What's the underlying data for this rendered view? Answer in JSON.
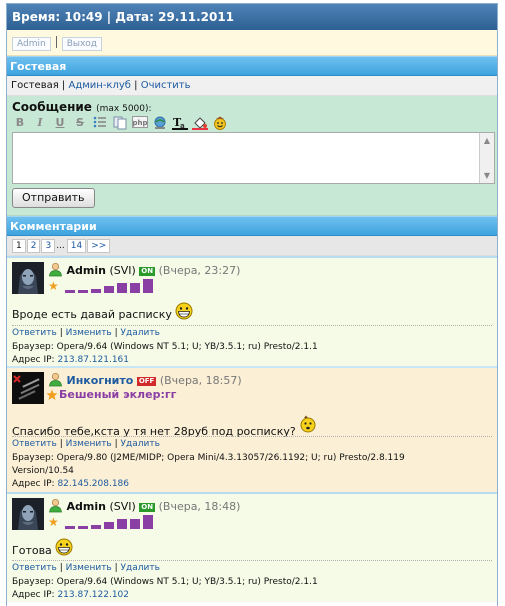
{
  "header": {
    "time_label": "Время: 10:49 | Дата: 29.11.2011"
  },
  "userbar": {
    "admin_label": "Admin",
    "separator": "|",
    "logout_label": "Выход"
  },
  "guestbook": {
    "title": "Гостевая",
    "nav": {
      "current": "Гостевая",
      "admin_club": "Админ-клуб",
      "clear": "Очистить",
      "sep": "|"
    }
  },
  "form": {
    "label": "Сообщение",
    "limit": "(max 5000):",
    "message_value": "",
    "submit_label": "Отправить",
    "toolbar": [
      "bold-icon",
      "italic-icon",
      "underline-icon",
      "strikethrough-icon",
      "list-icon",
      "copy-icon",
      "php-icon",
      "link-icon",
      "text-color-icon",
      "fill-color-icon",
      "smiley-icon"
    ]
  },
  "comments": {
    "title": "Комментарии",
    "pager": {
      "pages": [
        "1",
        "2",
        "3"
      ],
      "ellipsis": "...",
      "last": "14",
      "next": ">>",
      "current": "1"
    },
    "items": [
      {
        "author": "Admin",
        "role": "(SVI)",
        "status": "ON",
        "time": "(Вчера, 23:27)",
        "text": "Вроде есть давай расписку",
        "reply": "Ответить",
        "edit": "Изменить",
        "delete": "Удалить",
        "sep": "|",
        "browser": "Браузер: Opera/9.64 (Windows NT 5.1; U; YB/3.5.1; ru) Presto/2.1.1",
        "ip_label": "Адрес IP:",
        "ip": "213.87.121.161"
      },
      {
        "author": "Инкогнито",
        "status": "OFF",
        "time": "(Вчера, 18:57)",
        "subtitle": "Бешеный эклер:гг",
        "text": "Спасибо тебе,кста у тя нет 28руб под росписку?",
        "reply": "Ответить",
        "edit": "Изменить",
        "delete": "Удалить",
        "sep": "|",
        "browser": "Браузер: Opera/9.80 (J2ME/MIDP; Opera Mini/4.3.13057/26.1192; U; ru) Presto/2.8.119",
        "browser2": "Version/10.54",
        "ip_label": "Адрес IP:",
        "ip": "82.145.208.186"
      },
      {
        "author": "Admin",
        "role": "(SVI)",
        "status": "ON",
        "time": "(Вчера, 18:48)",
        "text": "Готова",
        "reply": "Ответить",
        "edit": "Изменить",
        "delete": "Удалить",
        "sep": "|",
        "browser": "Браузер: Opera/9.64 (Windows NT 5.1; U; YB/3.5.1; ru) Presto/2.1.1",
        "ip_label": "Адрес IP:",
        "ip": "213.87.122.102"
      }
    ]
  },
  "colors": {
    "header_blue": "#2d5f92",
    "section_blue": "#3ea3de",
    "form_green": "#c8e8d6",
    "comment_bg": "#f5fbe7",
    "comment_alt_bg": "#fbf0d6",
    "rank_bar": "#8a3fa5",
    "status_on": "#2a9a2a",
    "status_off": "#d12a2a"
  }
}
